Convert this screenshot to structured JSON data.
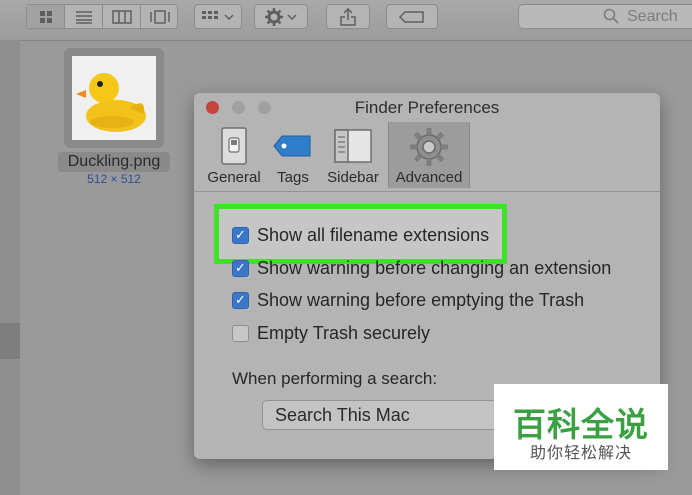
{
  "toolbar": {
    "view_modes": [
      "icon-view-icon",
      "list-view-icon",
      "column-view-icon",
      "coverflow-view-icon"
    ],
    "search_placeholder": "Search"
  },
  "desktop_file": {
    "name": "Duckling.png",
    "dimensions": "512 × 512"
  },
  "prefs_window": {
    "title": "Finder Preferences",
    "tabs": [
      {
        "label": "General",
        "icon": "general-switch-icon"
      },
      {
        "label": "Tags",
        "icon": "tag-icon"
      },
      {
        "label": "Sidebar",
        "icon": "sidebar-icon"
      },
      {
        "label": "Advanced",
        "icon": "gear-icon",
        "active": true
      }
    ],
    "options": [
      {
        "label": "Show all filename extensions",
        "checked": true
      },
      {
        "label": "Show warning before changing an extension",
        "checked": true
      },
      {
        "label": "Show warning before emptying the Trash",
        "checked": true
      },
      {
        "label": "Empty Trash securely",
        "checked": false
      }
    ],
    "search_label": "When performing a search:",
    "search_scope": "Search This Mac"
  },
  "watermark": {
    "title": "百科全说",
    "subtitle": "助你轻松解决"
  },
  "colors": {
    "highlight": "#40e12b",
    "checkbox_blue": "#3b77c9",
    "watermark_green": "#3aa041"
  }
}
